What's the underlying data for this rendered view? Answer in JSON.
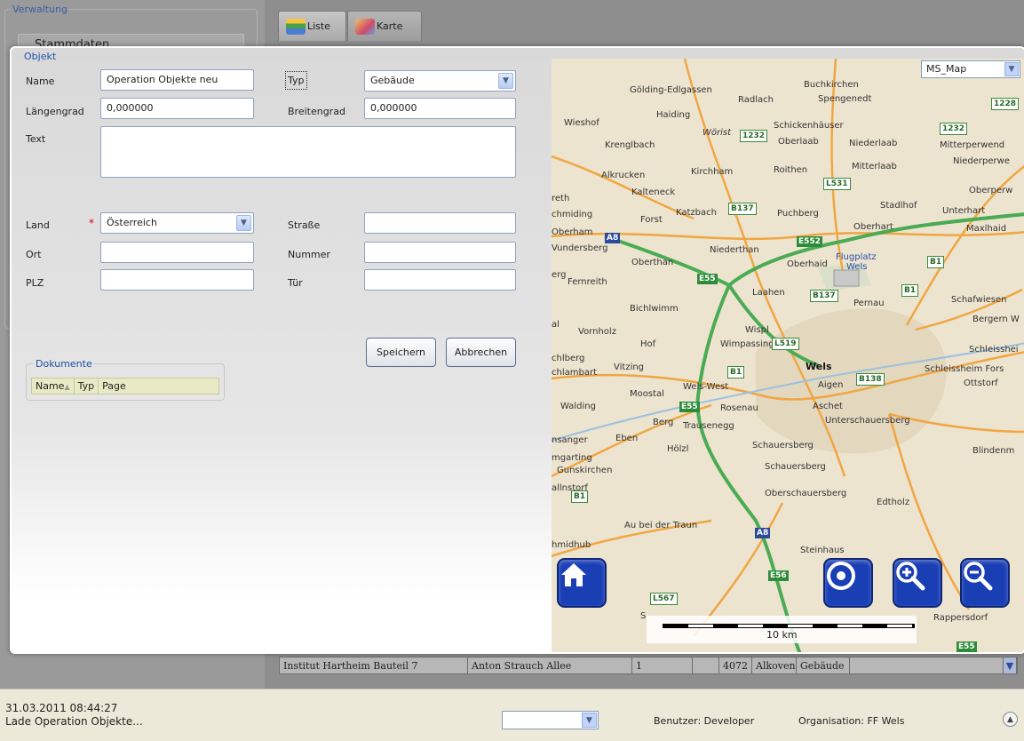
{
  "background": {
    "panel_title": "Verwaltung",
    "section": "Stammdaten",
    "tabs": [
      {
        "label": "Liste",
        "icon": "list-icon"
      },
      {
        "label": "Karte",
        "icon": "map-icon"
      }
    ],
    "row": [
      "Institut Hartheim Bauteil 7",
      "Anton Strauch Allee",
      "1",
      "",
      "4072",
      "Alkoven",
      "Gebäude"
    ]
  },
  "dialog": {
    "title": "Objekt",
    "labels": {
      "name": "Name",
      "typ": "Typ",
      "laengengrad": "Längengrad",
      "breitengrad": "Breitengrad",
      "text": "Text",
      "land": "Land",
      "strasse": "Straße",
      "ort": "Ort",
      "nummer": "Nummer",
      "plz": "PLZ",
      "tuer": "Tür"
    },
    "values": {
      "name": "Operation Objekte neu",
      "typ": "Gebäude",
      "laengengrad": "0,000000",
      "breitengrad": "0,000000",
      "text": "",
      "land": "Österreich",
      "strasse": "",
      "ort": "",
      "nummer": "",
      "plz": "",
      "tuer": ""
    },
    "required_marker": "*",
    "buttons": {
      "save": "Speichern",
      "cancel": "Abbrechen"
    },
    "documents": {
      "title": "Dokumente",
      "columns": [
        "Name",
        "Typ",
        "Page"
      ]
    }
  },
  "map": {
    "layer_select": "MS_Map",
    "scale": "10 km",
    "labels": [
      "Gölding-Edlgassen",
      "Radlach",
      "Buchkirchen",
      "Spengenedt",
      "Haiding",
      "Wieshof",
      "Wörist",
      "Schickenhäuser",
      "Krenglbach",
      "Oberlaab",
      "Niederlaab",
      "Mitterperwend",
      "Niederperwe",
      "Alkrucken",
      "Kirchham",
      "Roithen",
      "Mitterlaab",
      "Kalteneck",
      "Oberperw",
      "reth",
      "chmiding",
      "Forst",
      "Katzbach",
      "Puchberg",
      "Stadlhof",
      "Unterhart",
      "Oberhart",
      "Maxlhaid",
      "Oberham",
      "Niederthan",
      "Vundersberg",
      "Oberthan",
      "Oberhaid",
      "Flugplatz",
      "Wels",
      "erg",
      "Fernreith",
      "Laahen",
      "Pernau",
      "Schafwiesen",
      "Bichlwimm",
      "Bergern W",
      "al",
      "Vornholz",
      "Wispl",
      "Hof",
      "Wimpassing",
      "Schleisshei",
      "chlberg",
      "Vitzing",
      "Wels",
      "Schleissheim Fors",
      "chlambart",
      "Moostal",
      "Wels-West",
      "Aigen",
      "Ottstorf",
      "Walding",
      "Rosenau",
      "Aschet",
      "Berg",
      "Unterschauersberg",
      "Trausenegg",
      "nsanger",
      "Eben",
      "Hölzl",
      "Schauersberg",
      "mgarting",
      "Gunskirchen",
      "Schauersberg",
      "Blindenm",
      "allnstorf",
      "Oberschauersberg",
      "Edtholz",
      "Au bei der Traun",
      "hmidhub",
      "Steinhaus",
      "Rappersdorf",
      "S"
    ],
    "road_shields": {
      "b": [
        "1228",
        "1232",
        "1232",
        "L531",
        "B137",
        "B1",
        "B137",
        "B1",
        "L519",
        "B1",
        "B138",
        "B1",
        "L567"
      ],
      "e": [
        "E552",
        "E55",
        "E55",
        "E56",
        "E55"
      ],
      "a": [
        "A8",
        "A8"
      ]
    },
    "buttons": [
      "home-icon",
      "locate-icon",
      "zoom-in-icon",
      "zoom-out-icon"
    ]
  },
  "statusbar": {
    "date": "31.03.2011 08:44:27",
    "message": "Lade Operation Objekte...",
    "select_value": "",
    "user": "Benutzer: Developer",
    "organisation": "Organisation: FF Wels"
  }
}
